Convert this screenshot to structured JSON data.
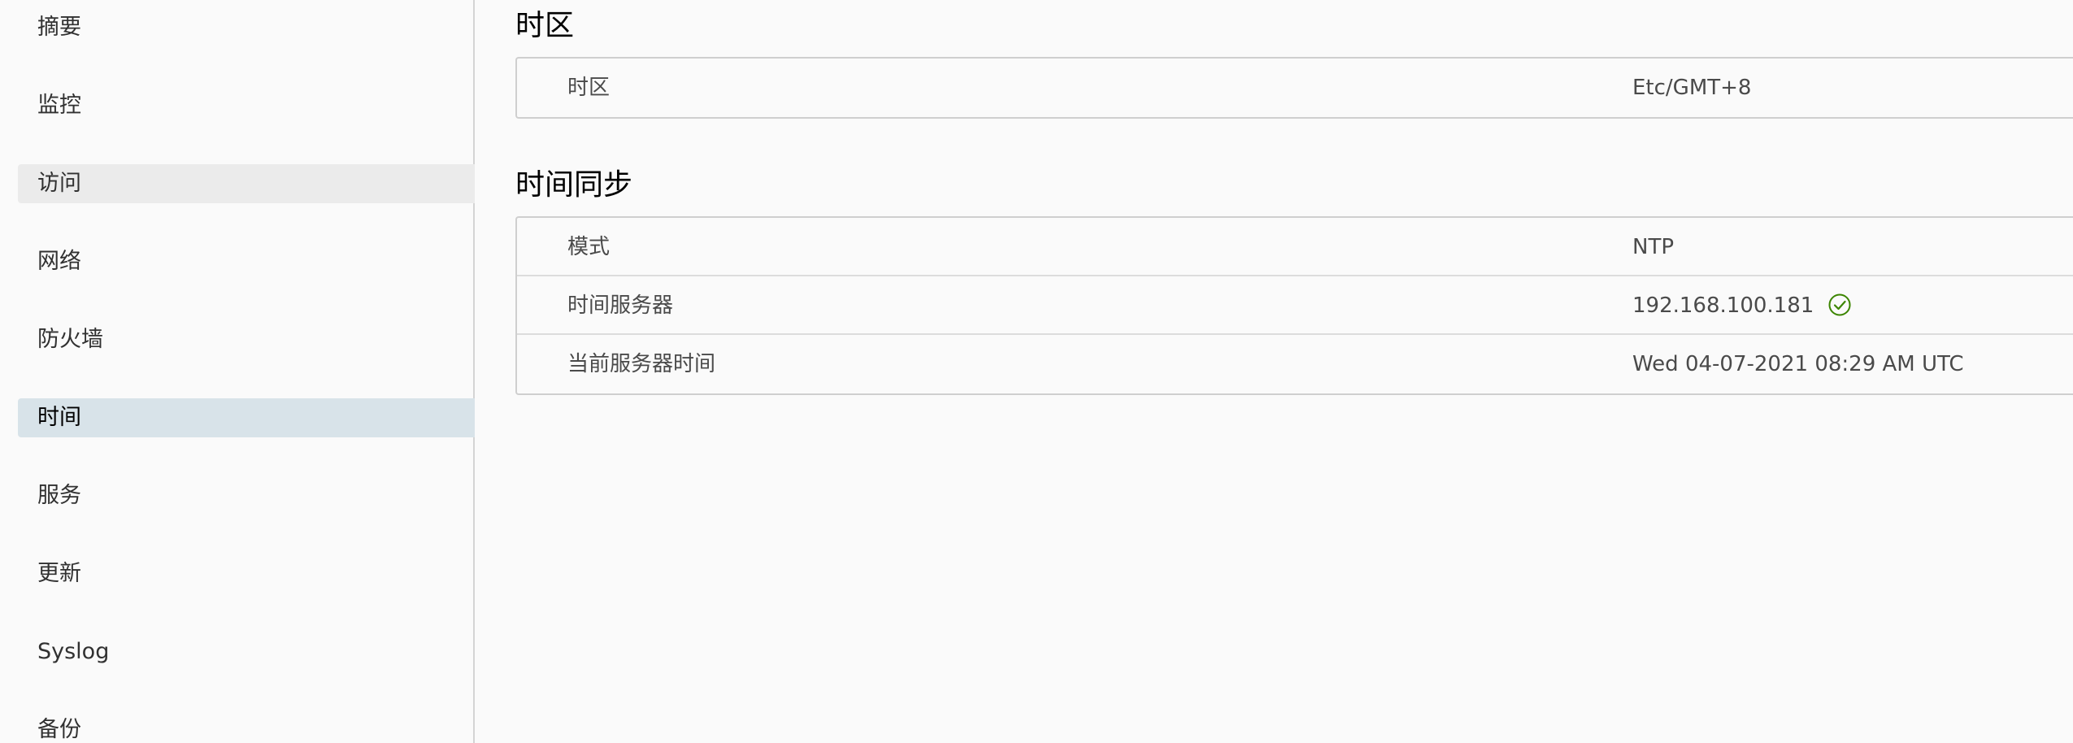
{
  "sidebar": {
    "items": [
      {
        "label": "摘要"
      },
      {
        "label": "监控"
      },
      {
        "label": "访问"
      },
      {
        "label": "网络"
      },
      {
        "label": "防火墙"
      },
      {
        "label": "时间"
      },
      {
        "label": "服务"
      },
      {
        "label": "更新"
      },
      {
        "label": "Syslog"
      },
      {
        "label": "备份"
      }
    ],
    "active": "时间",
    "hovered": "访问"
  },
  "timezone": {
    "title": "时区",
    "rows": [
      {
        "label": "时区",
        "value": "Etc/GMT+8"
      }
    ]
  },
  "time_sync": {
    "title": "时间同步",
    "rows": [
      {
        "label": "模式",
        "value": "NTP"
      },
      {
        "label": "时间服务器",
        "value": "192.168.100.181",
        "status_icon": "check-circle-icon"
      },
      {
        "label": "当前服务器时间",
        "value": "Wed 04-07-2021 08:29 AM UTC"
      }
    ]
  },
  "colors": {
    "active_nav_bg": "#d8e3e9",
    "hover_nav_bg": "#ebebeb",
    "success": "#3c8500"
  }
}
